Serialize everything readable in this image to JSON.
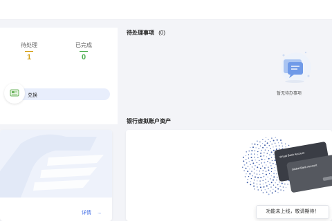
{
  "stats": {
    "pending": {
      "label": "待处理",
      "value": "1",
      "color": "#d4a017"
    },
    "completed": {
      "label": "已完成",
      "value": "0",
      "color": "#4caf50"
    }
  },
  "exchange": {
    "label": "兑换",
    "icon": "card-exchange-icon"
  },
  "todo": {
    "title": "待处理事项",
    "count": "(0)",
    "empty_text": "暂无待办事项",
    "icon": "empty-message-icon"
  },
  "virtual_account": {
    "title": "银行虚拟账户资产",
    "card_front_text": "Virtual Bank Account",
    "card_back_text": "Global Bank Account"
  },
  "promo_left": {
    "details_label": "详情"
  },
  "toast": {
    "text": "功能未上线，敬请期待！"
  },
  "colors": {
    "accent": "#3d6be5",
    "pill": "#e8eefc"
  }
}
